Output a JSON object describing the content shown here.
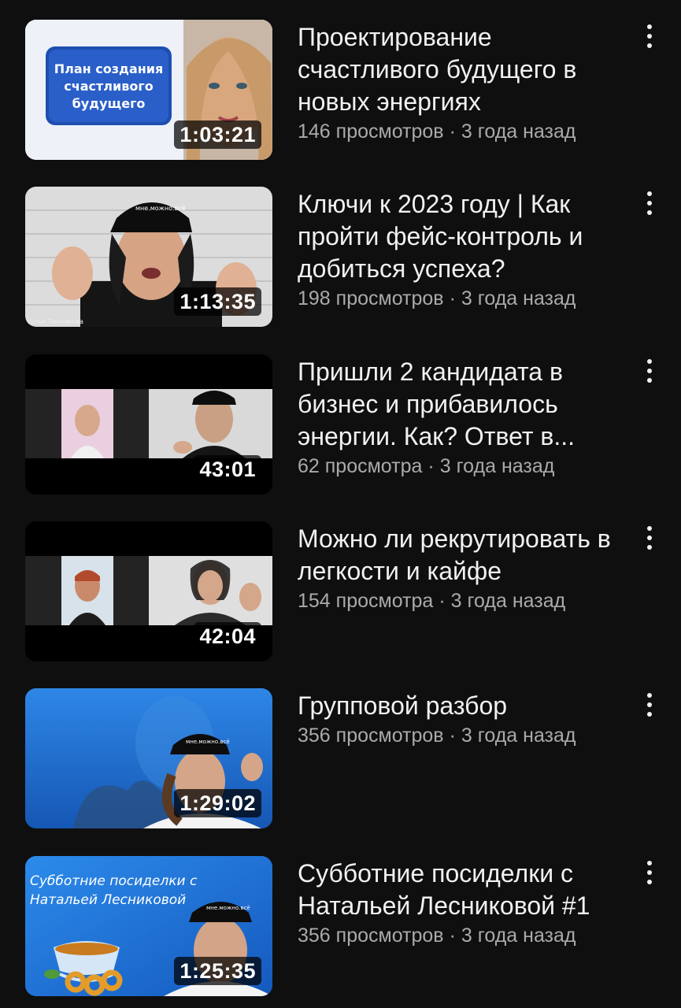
{
  "videos": [
    {
      "title": "Проектирование счастливого будущего в новых энергиях",
      "views": "146 просмотров",
      "age": "3 года назад",
      "duration": "1:03:21",
      "thumb_text": "План создания счастливого будущего"
    },
    {
      "title": "Ключи к 2023 году | Как пройти фейс-контроль и добиться успеха?",
      "views": "198 просмотров",
      "age": "3 года назад",
      "duration": "1:13:35",
      "thumb_text": "талья Лесникова"
    },
    {
      "title": "Пришли 2 кандидата в бизнес и прибавилось энергии. Как? Ответ в...",
      "views": "62 просмотра",
      "age": "3 года назад",
      "duration": "43:01"
    },
    {
      "title": "Можно ли рекрутировать в легкости и кайфе",
      "views": "154 просмотра",
      "age": "3 года назад",
      "duration": "42:04"
    },
    {
      "title": "Групповой разбор",
      "views": "356 просмотров",
      "age": "3 года назад",
      "duration": "1:29:02"
    },
    {
      "title": "Субботние посиделки с Натальей Лесниковой #1",
      "views": "356 просмотров",
      "age": "3 года назад",
      "duration": "1:25:35",
      "thumb_text": "Субботние посиделки с Натальей Лесниковой"
    }
  ],
  "separator": "·",
  "icons": {
    "more": "more-vert-icon"
  },
  "colors": {
    "background": "#0f0f0f",
    "title": "#f1f1f1",
    "meta": "#aaaaaa"
  }
}
